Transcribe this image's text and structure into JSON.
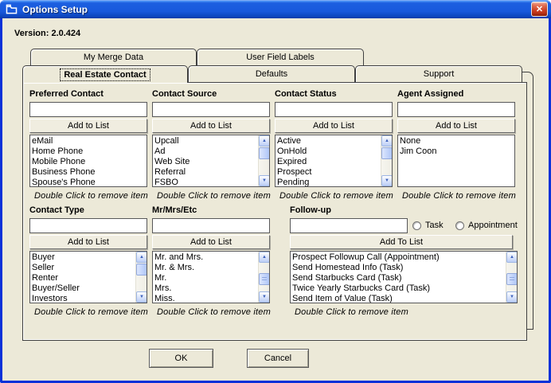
{
  "window": {
    "title": "Options Setup",
    "version_label": "Version: 2.0.424",
    "close_glyph": "✕"
  },
  "colors": {
    "titlebar_blue": "#1859DC",
    "window_border": "#0831D9",
    "face": "#ECE9D8",
    "close_red": "#CC3F22",
    "scrollbar_blue": "#AFC6F8"
  },
  "tabs": {
    "row1": [
      {
        "label": "My Merge Data"
      },
      {
        "label": "User Field Labels"
      }
    ],
    "row2": [
      {
        "label": "Real Estate Contact",
        "active": true
      },
      {
        "label": "Defaults"
      },
      {
        "label": "Support"
      }
    ]
  },
  "hint": "Double Click to remove item",
  "sections": {
    "preferred_contact": {
      "title": "Preferred Contact",
      "input_value": "",
      "button": "Add to List",
      "items": [
        "eMail",
        "Home Phone",
        "Mobile Phone",
        "Business Phone",
        "Spouse's Phone"
      ]
    },
    "contact_source": {
      "title": "Contact Source",
      "input_value": "",
      "button": "Add to List",
      "items": [
        "Upcall",
        "Ad",
        "Web Site",
        "Referral",
        "FSBO"
      ]
    },
    "contact_status": {
      "title": "Contact Status",
      "input_value": "",
      "button": "Add to List",
      "items": [
        "Active",
        "OnHold",
        "Expired",
        "Prospect",
        "Pending"
      ]
    },
    "agent_assigned": {
      "title": "Agent Assigned",
      "input_value": "",
      "button": "Add to List",
      "items": [
        "None",
        "Jim Coon"
      ]
    },
    "contact_type": {
      "title": "Contact Type",
      "input_value": "",
      "button": "Add to List",
      "items": [
        "Buyer",
        "Seller",
        "Renter",
        "Buyer/Seller",
        "Investors"
      ]
    },
    "mr_mrs_etc": {
      "title": "Mr/Mrs/Etc",
      "input_value": "",
      "button": "Add to List",
      "items": [
        "Mr. and Mrs.",
        "Mr. & Mrs.",
        "Mr.",
        "Mrs.",
        "Miss."
      ]
    },
    "follow_up": {
      "title": "Follow-up",
      "input_value": "",
      "button": "Add To List",
      "radio_task": "Task",
      "radio_appointment": "Appointment",
      "items": [
        "Prospect Followup Call (Appointment)",
        "Send Homestead Info (Task)",
        "Send Starbucks Card (Task)",
        "Twice Yearly Starbucks Card (Task)",
        "Send Item of Value (Task)"
      ]
    }
  },
  "footer": {
    "ok": "OK",
    "cancel": "Cancel"
  }
}
